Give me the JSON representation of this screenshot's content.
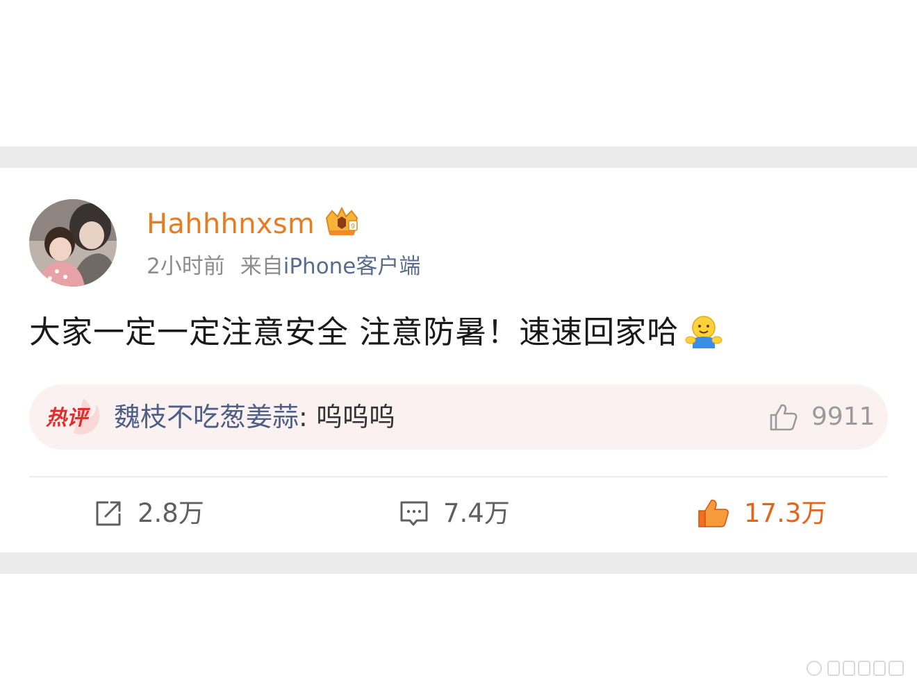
{
  "post": {
    "username": "Hahhhnxsm",
    "time": "2小时前",
    "source_prefix": "来自",
    "source_app": "iPhone客户端",
    "text": "大家一定一定注意安全 注意防暑！速速回家哈"
  },
  "hot_comment": {
    "tag": "热评",
    "user": "魏枝不吃葱姜蒜",
    "separator": ": ",
    "text": "呜呜呜",
    "likes": "9911"
  },
  "actions": {
    "repost_count": "2.8万",
    "comment_count": "7.4万",
    "like_count": "17.3万"
  },
  "colors": {
    "username": "#e77c22",
    "like_active": "#e8631a",
    "hot_tag": "#e02e2e",
    "source_link": "#5b6b8d"
  },
  "icons": {
    "vip_badge": "crown-badge-icon",
    "emoji": "hug-emoji-icon",
    "hot_like": "thumbs-up-outline-icon",
    "repost": "share-square-icon",
    "comment": "speech-bubble-icon",
    "like": "thumbs-up-filled-icon"
  }
}
